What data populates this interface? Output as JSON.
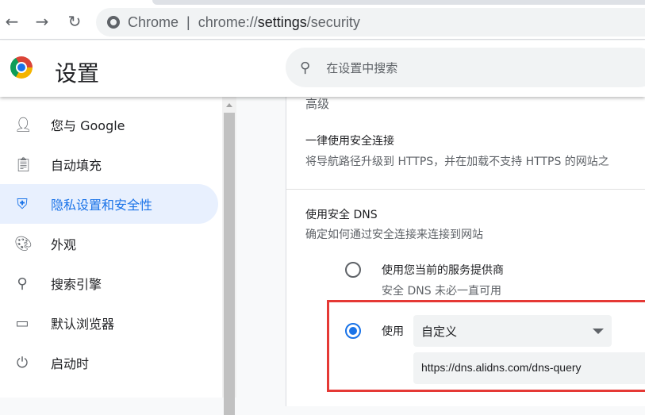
{
  "browser": {
    "omnibox_label": "Chrome",
    "url_prefix": "chrome://",
    "url_host": "settings",
    "url_path": "/security"
  },
  "header": {
    "title": "设置",
    "search_placeholder": "在设置中搜索"
  },
  "sidebar": {
    "items": [
      {
        "label": "您与 Google",
        "icon": "person-icon"
      },
      {
        "label": "自动填充",
        "icon": "clipboard-icon"
      },
      {
        "label": "隐私设置和安全性",
        "icon": "shield-icon",
        "active": true
      },
      {
        "label": "外观",
        "icon": "palette-icon"
      },
      {
        "label": "搜索引擎",
        "icon": "search-icon"
      },
      {
        "label": "默认浏览器",
        "icon": "browser-icon"
      },
      {
        "label": "启动时",
        "icon": "power-icon"
      }
    ]
  },
  "main": {
    "section_title": "高级",
    "https": {
      "title": "一律使用安全连接",
      "desc": "将导航路径升级到 HTTPS，并在加载不支持 HTTPS 的网站之"
    },
    "dns": {
      "title": "使用安全 DNS",
      "desc": "确定如何通过安全连接来连接到网站",
      "option_current": {
        "label": "使用您当前的服务提供商",
        "sub": "安全 DNS 未必一直可用",
        "selected": false
      },
      "option_custom": {
        "label": "使用",
        "provider": "自定义",
        "url": "https://dns.alidns.com/dns-query",
        "selected": true
      }
    }
  },
  "colors": {
    "accent": "#1a73e8",
    "highlight_box": "#e53935"
  }
}
